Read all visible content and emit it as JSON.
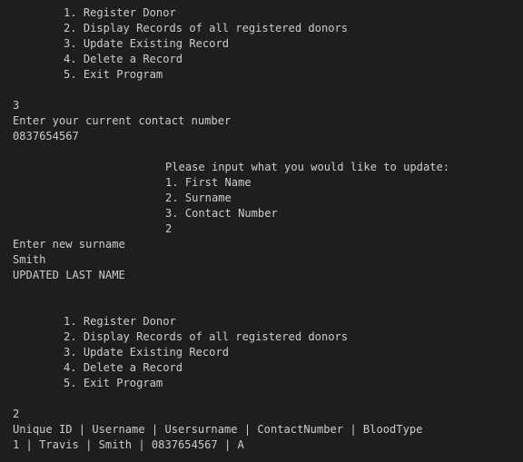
{
  "menu": {
    "items": [
      "1. Register Donor",
      "2. Display Records of all registered donors",
      "3. Update Existing Record",
      "4. Delete a Record",
      "5. Exit Program"
    ]
  },
  "session1": {
    "choice": "3",
    "prompt_contact": "Enter your current contact number",
    "contact_input": "0837654567"
  },
  "update_menu": {
    "heading": "Please input what you would like to update:",
    "items": [
      "1. First Name",
      "2. Surname",
      "3. Contact Number"
    ],
    "choice": "2"
  },
  "session2": {
    "prompt_surname": "Enter new surname",
    "surname_input": "Smith",
    "confirmation": "UPDATED LAST NAME"
  },
  "session3": {
    "choice": "2",
    "table_header": "Unique ID | Username | Usersurname | ContactNumber | BloodType",
    "rows": [
      "1 | Travis | Smith | 0837654567 | A"
    ]
  }
}
